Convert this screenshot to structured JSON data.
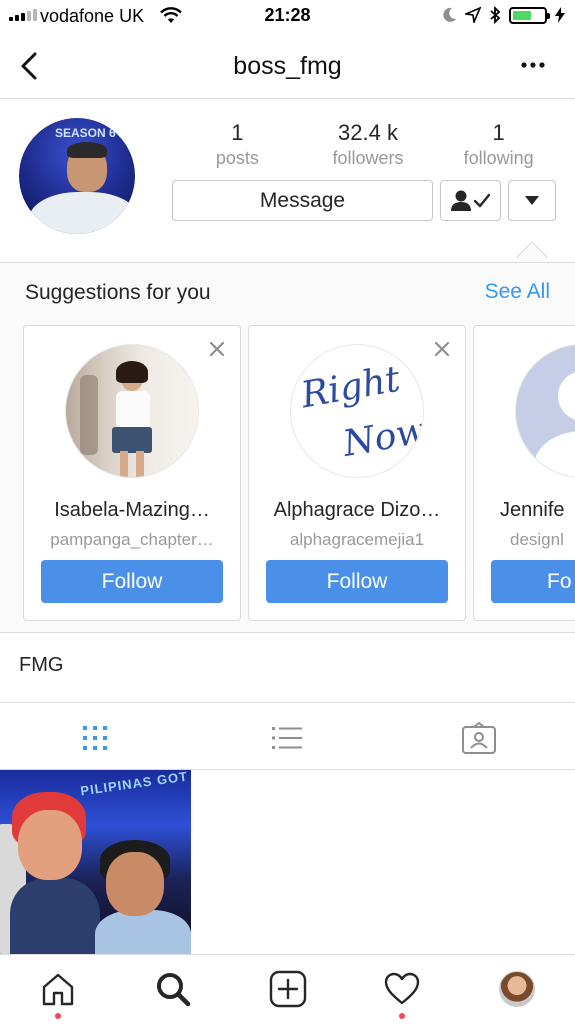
{
  "status_bar": {
    "carrier": "vodafone UK",
    "time": "21:28"
  },
  "nav": {
    "title": "boss_fmg"
  },
  "profile": {
    "stats": [
      {
        "value": "1",
        "label": "posts"
      },
      {
        "value": "32.4 k",
        "label": "followers"
      },
      {
        "value": "1",
        "label": "following"
      }
    ],
    "message_label": "Message",
    "avatar_badge": "SEASON 6"
  },
  "suggestions": {
    "title": "Suggestions for you",
    "see_all": "See All",
    "cards": [
      {
        "name": "Isabela-Mazing…",
        "handle": "pampanga_chapter…",
        "follow": "Follow"
      },
      {
        "name": "Alphagrace Dizo…",
        "handle": "alphagracemejia1",
        "follow": "Follow",
        "logo_line1": "Right",
        "logo_line2": "Now"
      },
      {
        "name": "Jennife",
        "handle": "designl",
        "follow": "Fo"
      }
    ]
  },
  "bio": "FMG",
  "grid": {
    "banner": "PILIPINAS GOT"
  },
  "colors": {
    "accent": "#3897f0",
    "follow_button": "#4a90e8",
    "notification_dot": "#ed4956",
    "battery": "#4cd964"
  },
  "icons": [
    "back-icon",
    "more-icon",
    "following-check-icon",
    "chevron-down-icon",
    "close-icon",
    "grid-icon",
    "list-icon",
    "tagged-icon",
    "home-icon",
    "search-icon",
    "add-icon",
    "heart-icon"
  ]
}
